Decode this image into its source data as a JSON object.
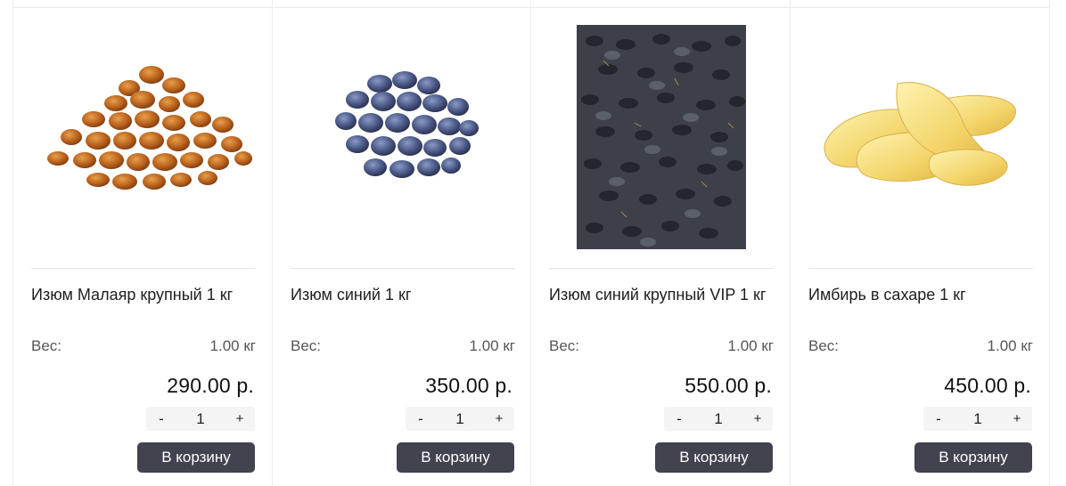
{
  "products": [
    {
      "title": "Изюм Малаяр крупный 1 кг",
      "weight_label": "Вес:",
      "weight_value": "1.00 кг",
      "price": "290.00 р.",
      "qty_minus": "-",
      "qty_value": "1",
      "qty_plus": "+",
      "cart_label": "В корзину",
      "image": "golden-raisins-icon"
    },
    {
      "title": "Изюм синий 1 кг",
      "weight_label": "Вес:",
      "weight_value": "1.00 кг",
      "price": "350.00 р.",
      "qty_minus": "-",
      "qty_value": "1",
      "qty_plus": "+",
      "cart_label": "В корзину",
      "image": "blue-raisins-icon"
    },
    {
      "title": "Изюм синий крупный VIP 1 кг",
      "weight_label": "Вес:",
      "weight_value": "1.00 кг",
      "price": "550.00 р.",
      "qty_minus": "-",
      "qty_value": "1",
      "qty_plus": "+",
      "cart_label": "В корзину",
      "image": "dark-raisins-photo"
    },
    {
      "title": "Имбирь в сахаре 1 кг",
      "weight_label": "Вес:",
      "weight_value": "1.00 кг",
      "price": "450.00 р.",
      "qty_minus": "-",
      "qty_value": "1",
      "qty_plus": "+",
      "cart_label": "В корзину",
      "image": "candied-ginger-icon"
    }
  ],
  "colors": {
    "cart_button": "#43424f",
    "qty_background": "#f4f4f4",
    "divider": "#e6e6e6"
  }
}
